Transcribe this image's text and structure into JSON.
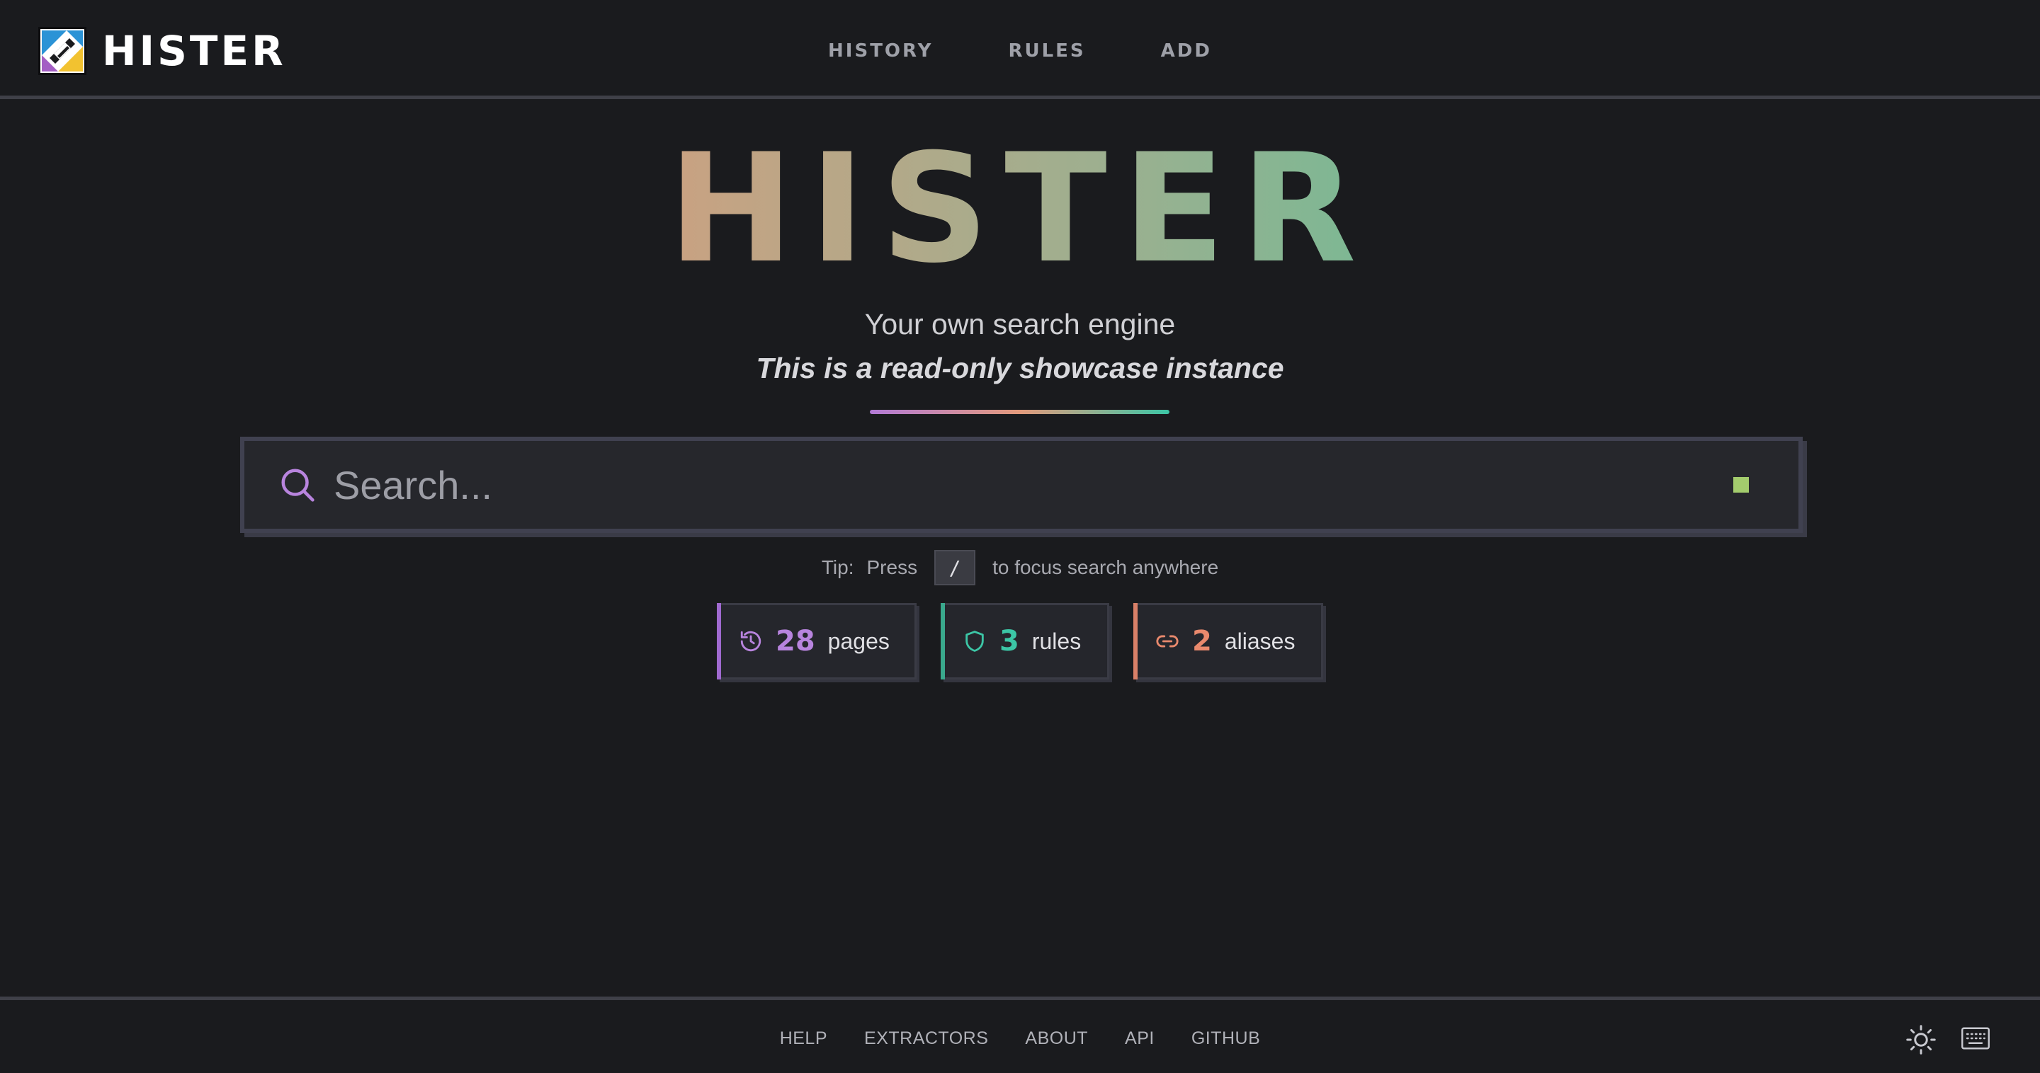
{
  "app": {
    "name": "HISTER",
    "logo_icon": "hister-logo-icon"
  },
  "nav": {
    "items": [
      {
        "label": "HISTORY"
      },
      {
        "label": "RULES"
      },
      {
        "label": "ADD"
      }
    ]
  },
  "hero": {
    "title": "HISTER",
    "subtitle": "Your own search engine",
    "tagline": "This is a read-only showcase instance"
  },
  "search": {
    "placeholder": "Search...",
    "value": "",
    "icon": "search-icon",
    "status_color": "#a3cc6d"
  },
  "tip": {
    "prefix": "Tip:",
    "press": "Press",
    "key": "/",
    "suffix": "to focus search anywhere"
  },
  "stats": [
    {
      "icon": "history-icon",
      "count": "28",
      "label": "pages",
      "color": "#b884de"
    },
    {
      "icon": "shield-icon",
      "count": "3",
      "label": "rules",
      "color": "#3cc6a6"
    },
    {
      "icon": "link-icon",
      "count": "2",
      "label": "aliases",
      "color": "#e9896d"
    }
  ],
  "footer": {
    "links": [
      {
        "label": "HELP"
      },
      {
        "label": "EXTRACTORS"
      },
      {
        "label": "ABOUT"
      },
      {
        "label": "API"
      },
      {
        "label": "GITHUB"
      }
    ],
    "theme_icon": "sun-icon",
    "keyboard_icon": "keyboard-icon"
  },
  "colors": {
    "background": "#1a1b1e",
    "gradient_start": "#e9896d",
    "gradient_end": "#3cc6a6",
    "accent_purple": "#b884de"
  }
}
